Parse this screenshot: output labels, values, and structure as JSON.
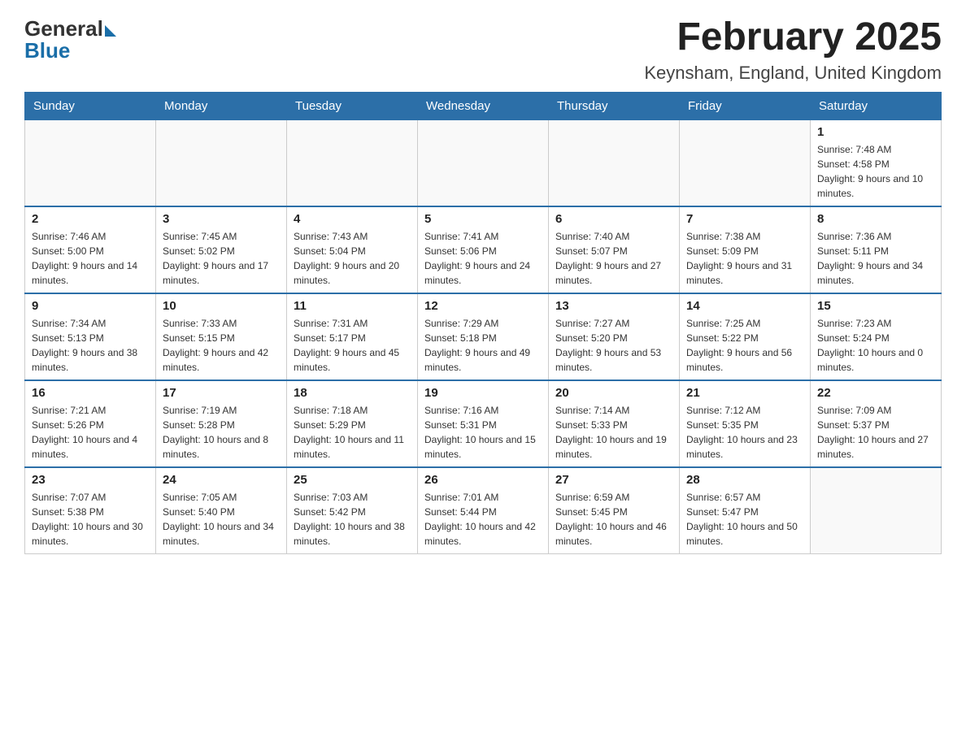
{
  "header": {
    "logo_general": "General",
    "logo_blue": "Blue",
    "month_title": "February 2025",
    "location": "Keynsham, England, United Kingdom"
  },
  "weekdays": [
    "Sunday",
    "Monday",
    "Tuesday",
    "Wednesday",
    "Thursday",
    "Friday",
    "Saturday"
  ],
  "weeks": [
    [
      {
        "day": "",
        "info": ""
      },
      {
        "day": "",
        "info": ""
      },
      {
        "day": "",
        "info": ""
      },
      {
        "day": "",
        "info": ""
      },
      {
        "day": "",
        "info": ""
      },
      {
        "day": "",
        "info": ""
      },
      {
        "day": "1",
        "info": "Sunrise: 7:48 AM\nSunset: 4:58 PM\nDaylight: 9 hours and 10 minutes."
      }
    ],
    [
      {
        "day": "2",
        "info": "Sunrise: 7:46 AM\nSunset: 5:00 PM\nDaylight: 9 hours and 14 minutes."
      },
      {
        "day": "3",
        "info": "Sunrise: 7:45 AM\nSunset: 5:02 PM\nDaylight: 9 hours and 17 minutes."
      },
      {
        "day": "4",
        "info": "Sunrise: 7:43 AM\nSunset: 5:04 PM\nDaylight: 9 hours and 20 minutes."
      },
      {
        "day": "5",
        "info": "Sunrise: 7:41 AM\nSunset: 5:06 PM\nDaylight: 9 hours and 24 minutes."
      },
      {
        "day": "6",
        "info": "Sunrise: 7:40 AM\nSunset: 5:07 PM\nDaylight: 9 hours and 27 minutes."
      },
      {
        "day": "7",
        "info": "Sunrise: 7:38 AM\nSunset: 5:09 PM\nDaylight: 9 hours and 31 minutes."
      },
      {
        "day": "8",
        "info": "Sunrise: 7:36 AM\nSunset: 5:11 PM\nDaylight: 9 hours and 34 minutes."
      }
    ],
    [
      {
        "day": "9",
        "info": "Sunrise: 7:34 AM\nSunset: 5:13 PM\nDaylight: 9 hours and 38 minutes."
      },
      {
        "day": "10",
        "info": "Sunrise: 7:33 AM\nSunset: 5:15 PM\nDaylight: 9 hours and 42 minutes."
      },
      {
        "day": "11",
        "info": "Sunrise: 7:31 AM\nSunset: 5:17 PM\nDaylight: 9 hours and 45 minutes."
      },
      {
        "day": "12",
        "info": "Sunrise: 7:29 AM\nSunset: 5:18 PM\nDaylight: 9 hours and 49 minutes."
      },
      {
        "day": "13",
        "info": "Sunrise: 7:27 AM\nSunset: 5:20 PM\nDaylight: 9 hours and 53 minutes."
      },
      {
        "day": "14",
        "info": "Sunrise: 7:25 AM\nSunset: 5:22 PM\nDaylight: 9 hours and 56 minutes."
      },
      {
        "day": "15",
        "info": "Sunrise: 7:23 AM\nSunset: 5:24 PM\nDaylight: 10 hours and 0 minutes."
      }
    ],
    [
      {
        "day": "16",
        "info": "Sunrise: 7:21 AM\nSunset: 5:26 PM\nDaylight: 10 hours and 4 minutes."
      },
      {
        "day": "17",
        "info": "Sunrise: 7:19 AM\nSunset: 5:28 PM\nDaylight: 10 hours and 8 minutes."
      },
      {
        "day": "18",
        "info": "Sunrise: 7:18 AM\nSunset: 5:29 PM\nDaylight: 10 hours and 11 minutes."
      },
      {
        "day": "19",
        "info": "Sunrise: 7:16 AM\nSunset: 5:31 PM\nDaylight: 10 hours and 15 minutes."
      },
      {
        "day": "20",
        "info": "Sunrise: 7:14 AM\nSunset: 5:33 PM\nDaylight: 10 hours and 19 minutes."
      },
      {
        "day": "21",
        "info": "Sunrise: 7:12 AM\nSunset: 5:35 PM\nDaylight: 10 hours and 23 minutes."
      },
      {
        "day": "22",
        "info": "Sunrise: 7:09 AM\nSunset: 5:37 PM\nDaylight: 10 hours and 27 minutes."
      }
    ],
    [
      {
        "day": "23",
        "info": "Sunrise: 7:07 AM\nSunset: 5:38 PM\nDaylight: 10 hours and 30 minutes."
      },
      {
        "day": "24",
        "info": "Sunrise: 7:05 AM\nSunset: 5:40 PM\nDaylight: 10 hours and 34 minutes."
      },
      {
        "day": "25",
        "info": "Sunrise: 7:03 AM\nSunset: 5:42 PM\nDaylight: 10 hours and 38 minutes."
      },
      {
        "day": "26",
        "info": "Sunrise: 7:01 AM\nSunset: 5:44 PM\nDaylight: 10 hours and 42 minutes."
      },
      {
        "day": "27",
        "info": "Sunrise: 6:59 AM\nSunset: 5:45 PM\nDaylight: 10 hours and 46 minutes."
      },
      {
        "day": "28",
        "info": "Sunrise: 6:57 AM\nSunset: 5:47 PM\nDaylight: 10 hours and 50 minutes."
      },
      {
        "day": "",
        "info": ""
      }
    ]
  ]
}
